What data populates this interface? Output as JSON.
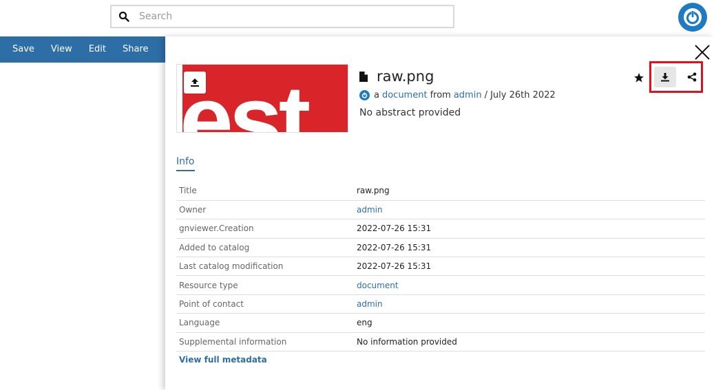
{
  "search": {
    "placeholder": "Search"
  },
  "action_bar": {
    "items": [
      "Save",
      "View",
      "Edit",
      "Share"
    ]
  },
  "resource": {
    "title": "raw.png",
    "byline_prefix": "a",
    "resource_type": "document",
    "from_word": "from",
    "owner": "admin",
    "date": "/ July 26th 2022",
    "abstract": "No abstract provided",
    "thumbnail_text": "est"
  },
  "tabs": [
    {
      "label": "Info"
    }
  ],
  "info_rows": [
    {
      "key": "Title",
      "value": "raw.png",
      "link": false
    },
    {
      "key": "Owner",
      "value": "admin",
      "link": true
    },
    {
      "key": "gnviewer.Creation",
      "value": "2022-07-26 15:31",
      "link": false
    },
    {
      "key": "Added to catalog",
      "value": "2022-07-26 15:31",
      "link": false
    },
    {
      "key": "Last catalog modification",
      "value": "2022-07-26 15:31",
      "link": false
    },
    {
      "key": "Resource type",
      "value": "document",
      "link": true
    },
    {
      "key": "Point of contact",
      "value": "admin",
      "link": true
    },
    {
      "key": "Language",
      "value": "eng",
      "link": false
    },
    {
      "key": "Supplemental information",
      "value": "No information provided",
      "link": false
    }
  ],
  "full_metadata_label": "View full metadata",
  "colors": {
    "accent": "#2d6ea6",
    "logo": "#1f7bc1",
    "highlight": "#e0101e",
    "thumb_red": "#d9252a"
  },
  "icons": [
    "search-icon",
    "geonode-logo-icon",
    "close-icon",
    "upload-icon",
    "file-icon",
    "star-icon",
    "download-icon",
    "share-icon"
  ]
}
